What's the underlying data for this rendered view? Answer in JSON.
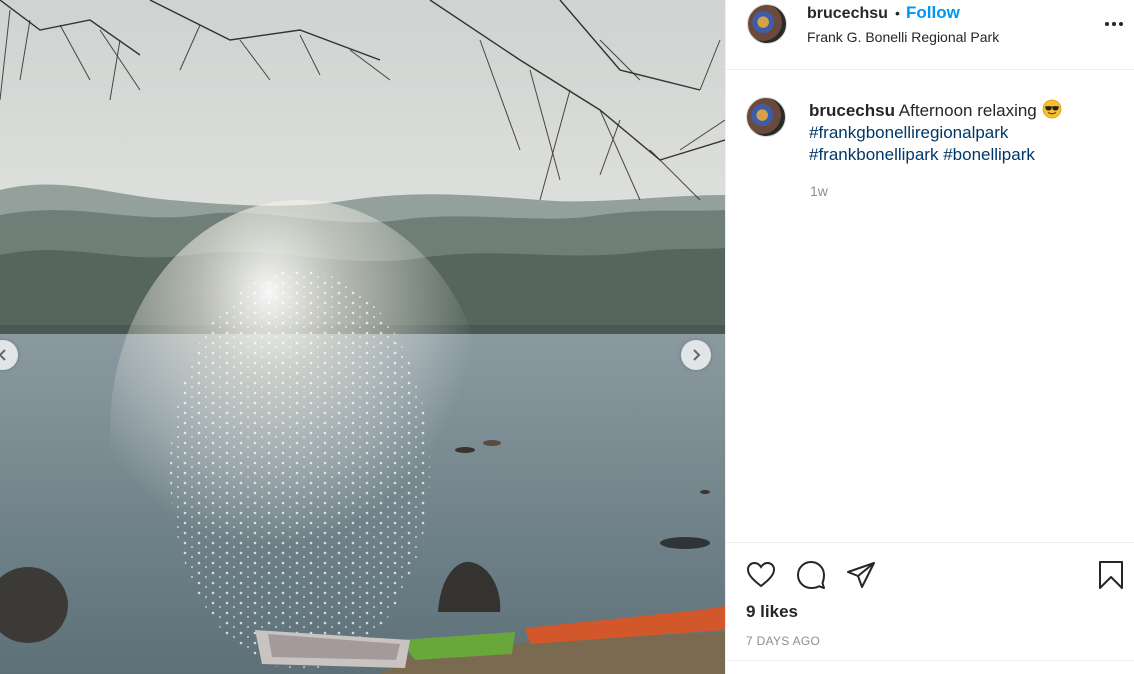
{
  "post": {
    "image_alt": "Sunlight sparkling on a lake with kayaks on the shore",
    "header": {
      "username": "brucechsu",
      "separator": "•",
      "follow_label": "Follow",
      "location": "Frank G. Bonelli Regional Park",
      "more_icon": "more-options-icon"
    },
    "caption": {
      "username": "brucechsu",
      "text": "Afternoon relaxing",
      "emoji": "sunglasses-emoji",
      "hashtags": [
        "#frankgbonelliregionalpark",
        "#frankbonellipark",
        "#bonellipark"
      ],
      "time_ago": "1w"
    },
    "actions": {
      "icons": [
        "heart-icon",
        "comment-icon",
        "share-icon",
        "bookmark-icon"
      ],
      "likes": "9 likes",
      "date": "7 DAYS AGO"
    },
    "carousel": {
      "prev_icon": "chevron-left-icon",
      "next_icon": "chevron-right-icon"
    }
  },
  "colors": {
    "follow": "#0095f6",
    "hashtag": "#00376b",
    "muted": "#8e8e8e",
    "text": "#262626",
    "border": "#efefef"
  }
}
